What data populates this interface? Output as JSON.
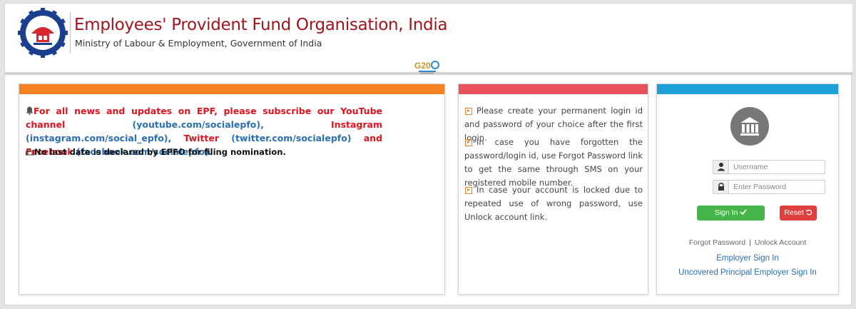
{
  "header": {
    "org_name": "Employees' Provident Fund Organisation, India",
    "ministry": "Ministry of Labour & Employment, Government of India",
    "g20_label": "G20"
  },
  "news": {
    "line1_red_a": "For all news and updates on EPF, please subscribe our YouTube channel",
    "youtube_link": "(youtube.com/socialepfo),",
    "instagram_label": "Instagram",
    "instagram_link": "(instagram.com/social_epfo),",
    "twitter_label": "Twitter",
    "twitter_link": "(twitter.com/socialepfo)",
    "and_facebook": "and Facebook",
    "facebook_link": "(facebook.com/socialepfo).",
    "note": "No last date is declared by EPFO for filing nomination."
  },
  "info": {
    "items": [
      "Please create your permanent login id and password of your choice after the first login.",
      "In case you have forgotten the password/login id, use Forgot Password link to get the same through SMS on your registered mobile number.",
      "In case your account is locked due to repeated use of wrong password, use Unlock account link."
    ]
  },
  "login": {
    "username_placeholder": "Username",
    "password_placeholder": "Enter Password",
    "signin_label": "Sign In",
    "reset_label": "Reset",
    "forgot_password": "Forgot Password",
    "unlock_account": "Unlock Account",
    "employer_signin": "Employer Sign In",
    "uncovered_signin": "Uncovered Principal Employer Sign In"
  },
  "colors": {
    "brand_red": "#a0141c",
    "orange_bar": "#f58220",
    "red_bar": "#e8505b",
    "blue_bar": "#1ea1d9",
    "signin_green": "#45b549",
    "reset_red": "#e0403d",
    "link_blue": "#2a6fb3"
  }
}
